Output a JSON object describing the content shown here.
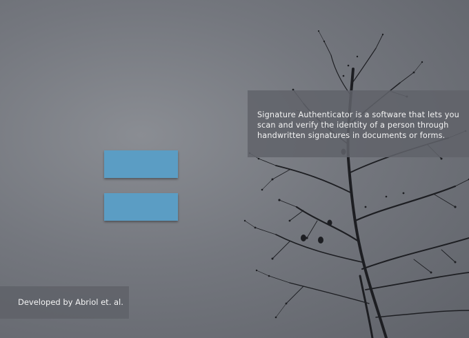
{
  "app": {
    "description": "Signature Authenticator is a software that lets you scan and verify the identity of a person through handwritten signatures in documents or forms.",
    "credit": "Developed by Abriol et. al."
  },
  "buttons": [
    {
      "label": ""
    },
    {
      "label": ""
    }
  ],
  "colors": {
    "background": "#74777e",
    "button": "#5b9dc4",
    "panel": "#60636a",
    "text": "#f4f4f4",
    "tree": "#1d1e22"
  },
  "background_image": "bare-tree-with-birds"
}
